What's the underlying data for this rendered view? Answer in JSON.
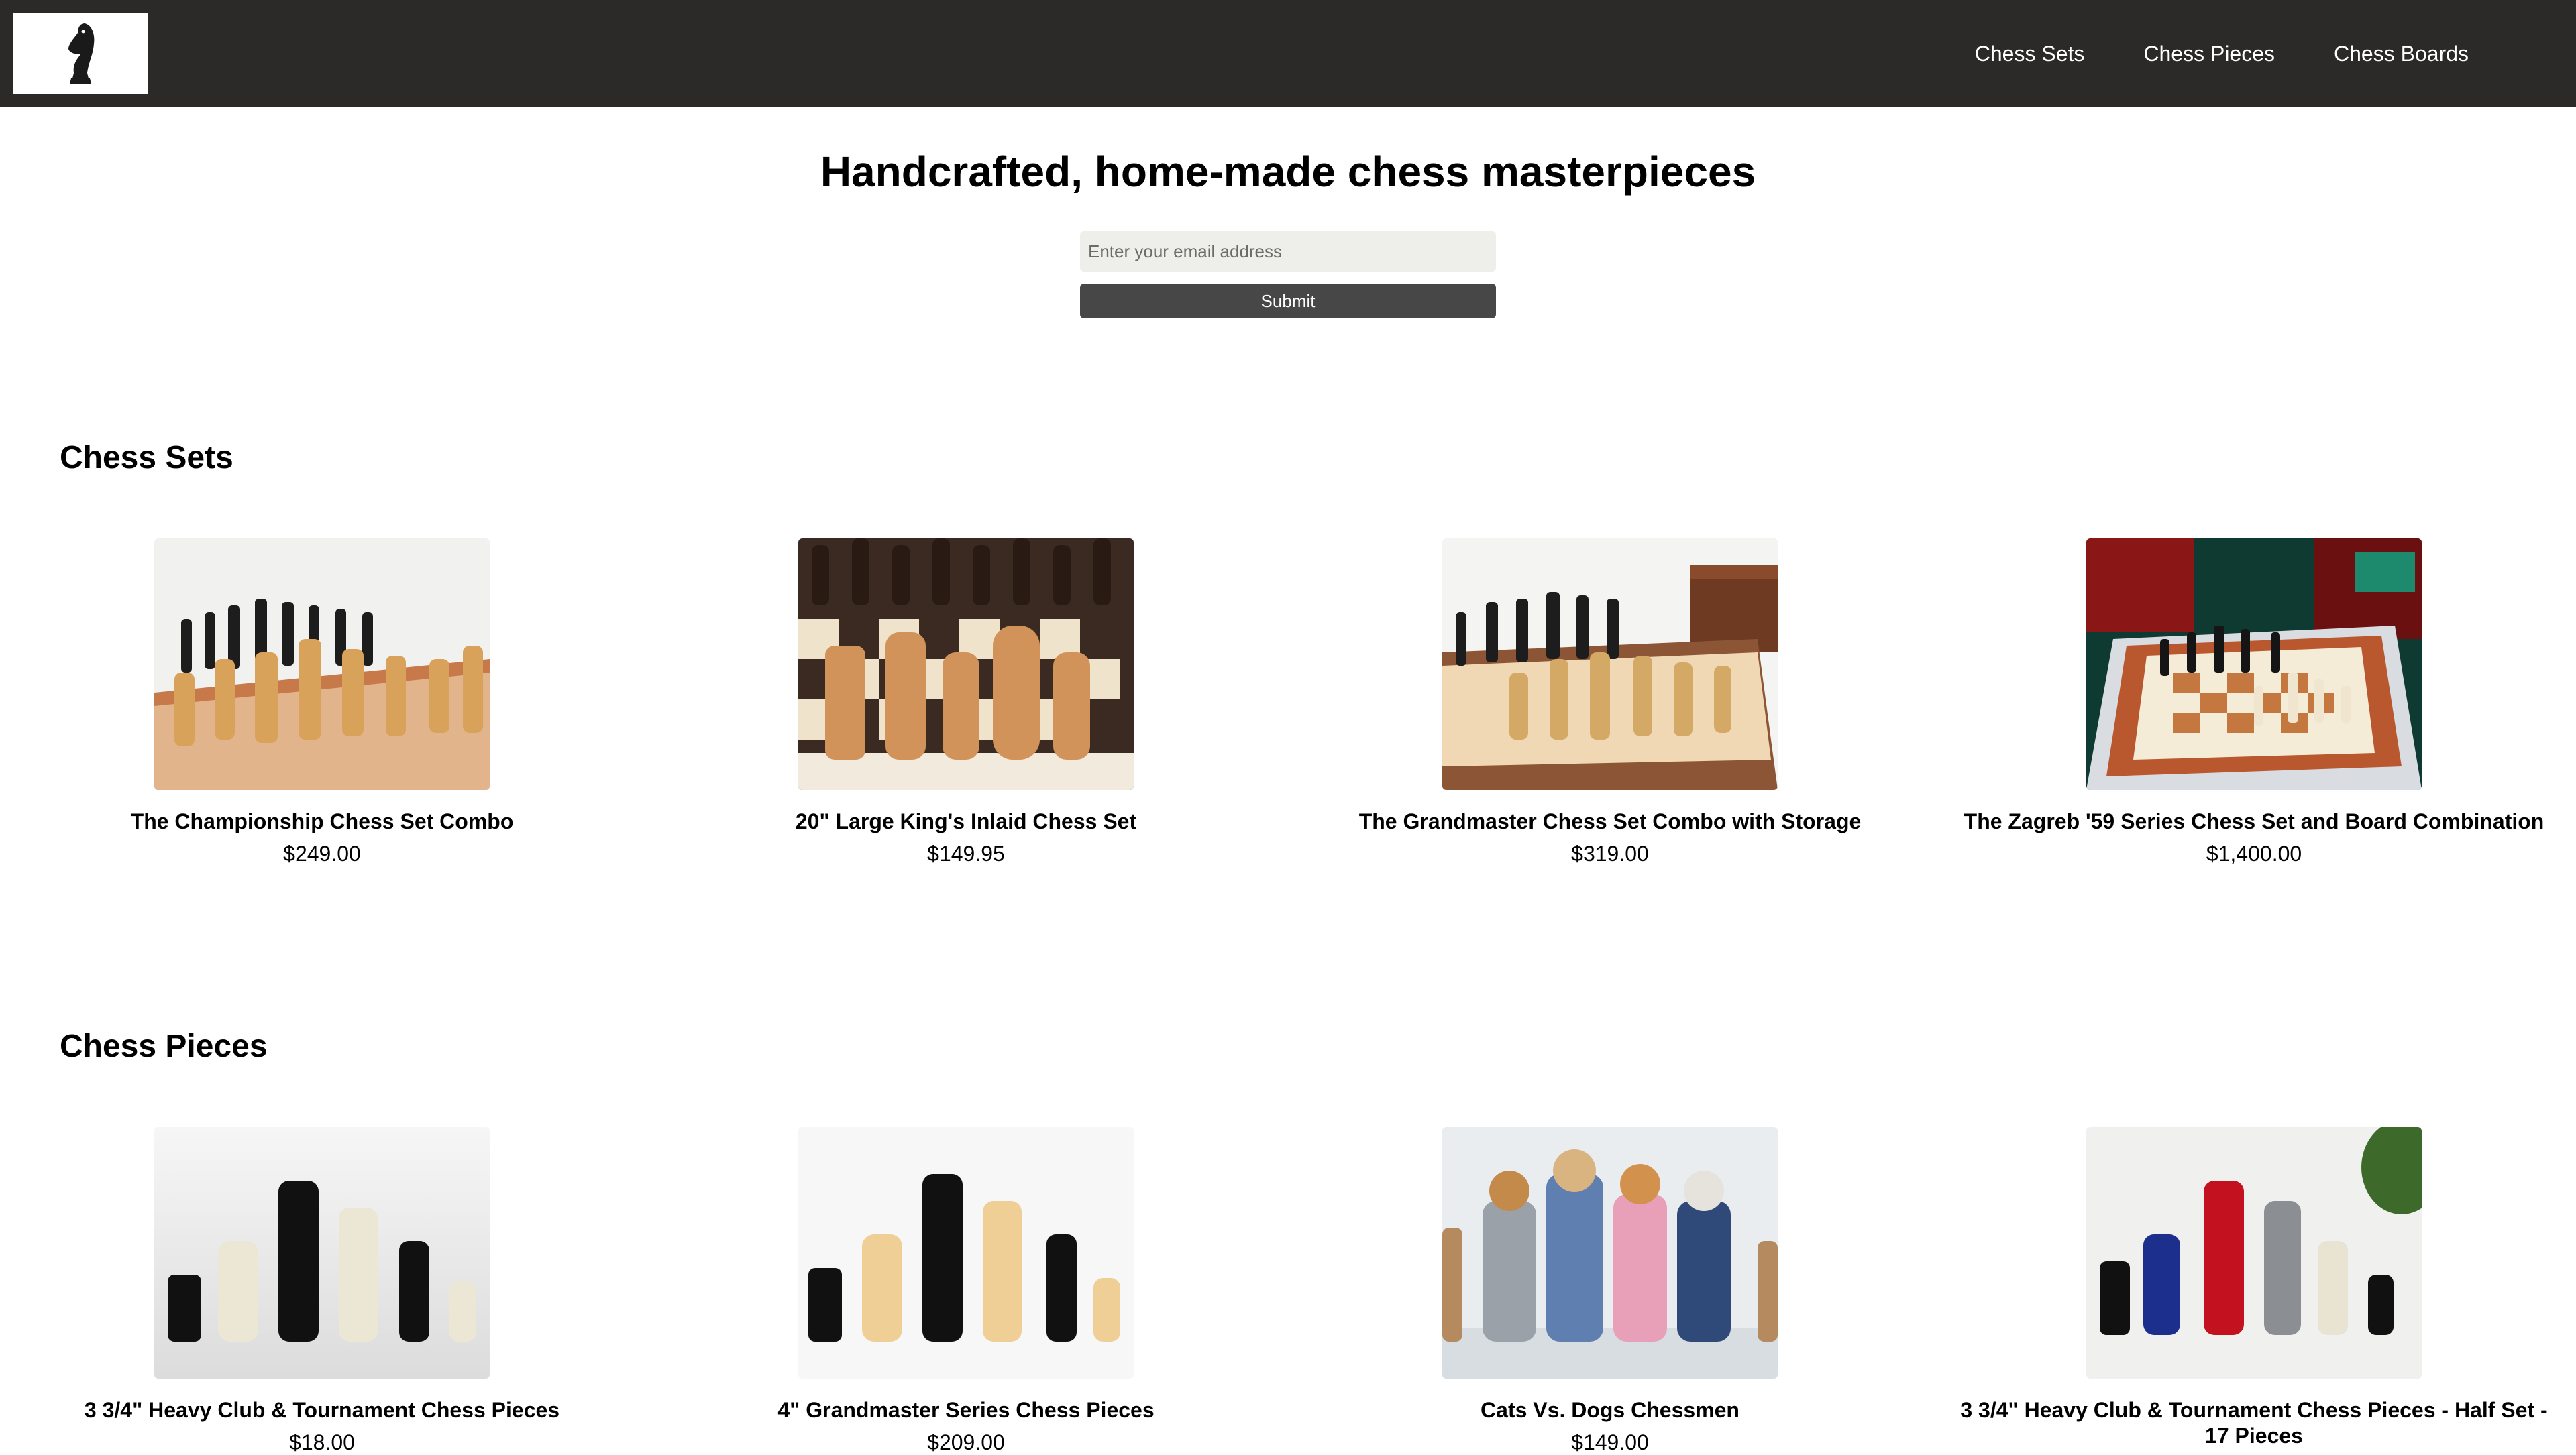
{
  "nav": {
    "links": [
      "Chess Sets",
      "Chess Pieces",
      "Chess Boards"
    ]
  },
  "hero": {
    "title": "Handcrafted, home-made chess masterpieces",
    "email_placeholder": "Enter your email address",
    "submit_label": "Submit"
  },
  "sections": [
    {
      "title": "Chess Sets",
      "products": [
        {
          "name": "The Championship Chess Set Combo",
          "price": "$249.00"
        },
        {
          "name": "20\" Large King's Inlaid Chess Set",
          "price": "$149.95"
        },
        {
          "name": "The Grandmaster Chess Set Combo with Storage",
          "price": "$319.00"
        },
        {
          "name": "The Zagreb '59 Series Chess Set and Board Combination",
          "price": "$1,400.00"
        }
      ]
    },
    {
      "title": "Chess Pieces",
      "products": [
        {
          "name": "3 3/4\" Heavy Club & Tournament Chess Pieces",
          "price": "$18.00"
        },
        {
          "name": "4\" Grandmaster Series Chess Pieces",
          "price": "$209.00"
        },
        {
          "name": "Cats Vs. Dogs Chessmen",
          "price": "$149.00"
        },
        {
          "name": "3 3/4\" Heavy Club & Tournament Chess Pieces - Half Set - 17 Pieces",
          "price": ""
        }
      ]
    }
  ],
  "colors": {
    "navbar": "#2b2a28",
    "button": "#474747",
    "input_bg": "#eeeeea"
  }
}
